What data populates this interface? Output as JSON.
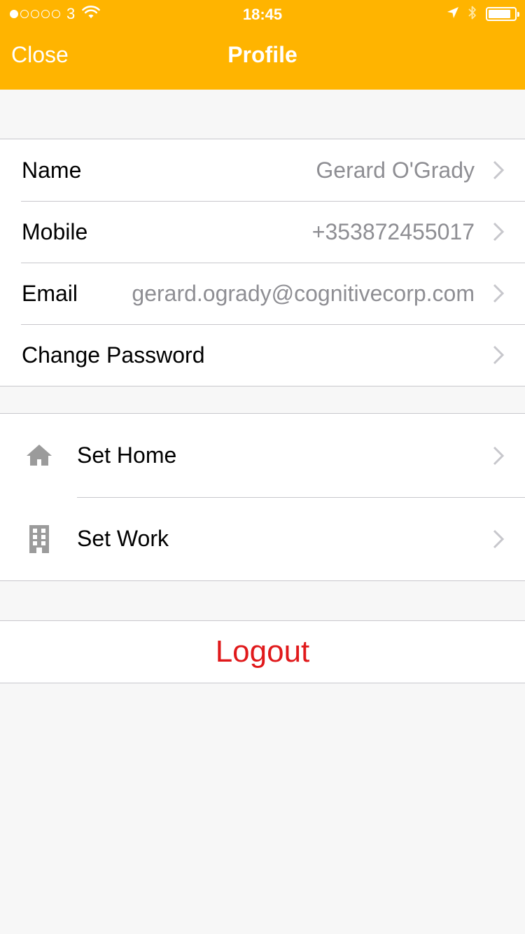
{
  "status_bar": {
    "signal_bars_filled": 1,
    "signal_bars_total": 5,
    "carrier": "3",
    "time": "18:45",
    "battery_level": 0.85,
    "icons": [
      "wifi-icon",
      "location-arrow-icon",
      "bluetooth-icon",
      "battery-icon"
    ]
  },
  "nav": {
    "close_label": "Close",
    "title": "Profile"
  },
  "account": [
    {
      "label": "Name",
      "value": "Gerard O'Grady"
    },
    {
      "label": "Mobile",
      "value": "+353872455017"
    },
    {
      "label": "Email",
      "value": "gerard.ogrady@cognitivecorp.com"
    },
    {
      "label": "Change Password",
      "value": ""
    }
  ],
  "places": [
    {
      "label": "Set Home",
      "icon": "home-icon"
    },
    {
      "label": "Set Work",
      "icon": "office-building-icon"
    }
  ],
  "logout_label": "Logout",
  "colors": {
    "header": "#ffb400",
    "logout": "#e0191b",
    "value_text": "#8e8e93",
    "background": "#f7f7f7"
  }
}
